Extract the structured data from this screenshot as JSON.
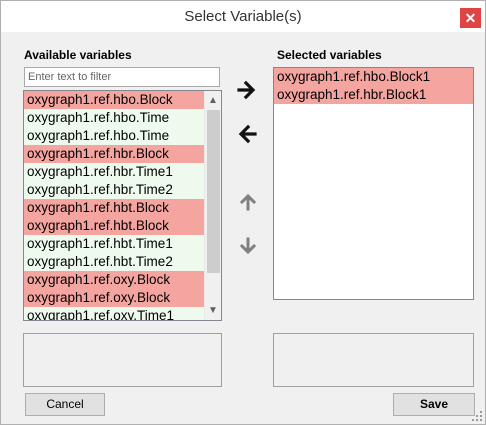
{
  "window": {
    "title": "Select Variable(s)",
    "close_label": "✕"
  },
  "available": {
    "label": "Available variables",
    "filter_placeholder": "Enter text to filter",
    "items": [
      {
        "label": "oxygraph1.ref.hbo.Block",
        "kind": "block"
      },
      {
        "label": "oxygraph1.ref.hbo.Time",
        "kind": "time"
      },
      {
        "label": "oxygraph1.ref.hbo.Time",
        "kind": "time"
      },
      {
        "label": "oxygraph1.ref.hbr.Block",
        "kind": "block"
      },
      {
        "label": "oxygraph1.ref.hbr.Time1",
        "kind": "time"
      },
      {
        "label": "oxygraph1.ref.hbr.Time2",
        "kind": "time"
      },
      {
        "label": "oxygraph1.ref.hbt.Block",
        "kind": "block"
      },
      {
        "label": "oxygraph1.ref.hbt.Block",
        "kind": "block"
      },
      {
        "label": "oxygraph1.ref.hbt.Time1",
        "kind": "time"
      },
      {
        "label": "oxygraph1.ref.hbt.Time2",
        "kind": "time"
      },
      {
        "label": "oxygraph1.ref.oxy.Block",
        "kind": "block"
      },
      {
        "label": "oxygraph1.ref.oxy.Block",
        "kind": "block"
      },
      {
        "label": "oxygraph1.ref.oxy.Time1",
        "kind": "time"
      }
    ]
  },
  "selected": {
    "label": "Selected variables",
    "items": [
      {
        "label": "oxygraph1.ref.hbo.Block1",
        "kind": "block"
      },
      {
        "label": "oxygraph1.ref.hbr.Block1",
        "kind": "block"
      }
    ]
  },
  "buttons": {
    "cancel": "Cancel",
    "save": "Save"
  },
  "colors": {
    "block_highlight": "#f4a5a0",
    "time_highlight": "#effaef",
    "close_red": "#e04343"
  },
  "icons": {
    "move_right": "arrow-right-icon",
    "move_left": "arrow-left-icon",
    "move_up": "arrow-up-icon",
    "move_down": "arrow-down-icon"
  }
}
